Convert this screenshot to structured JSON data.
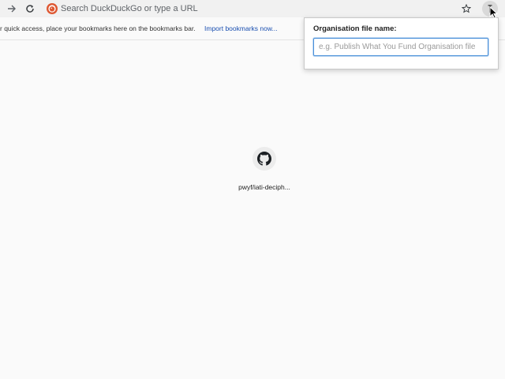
{
  "toolbar": {
    "forward_icon": "arrow-right-icon",
    "reload_icon": "reload-icon",
    "omnibox": {
      "logo_icon": "duckduckgo-logo-icon",
      "placeholder": "Search DuckDuckGo or type a URL"
    },
    "bookmark_icon": "star-icon",
    "extension_icon": "extension-icon"
  },
  "bookmarks_bar": {
    "message": "r quick access, place your bookmarks here on the bookmarks bar.",
    "import_link": "Import bookmarks now..."
  },
  "popup": {
    "label": "Organisation file name:",
    "input_placeholder": "e.g. Publish What You Fund Organisation file",
    "input_value": ""
  },
  "shortcut_tile": {
    "icon": "github-icon",
    "label": "pwyf/iati-deciph..."
  },
  "colors": {
    "link": "#1a4fb0",
    "focus_ring": "#4a90d9",
    "duckduckgo_orange": "#de5833"
  }
}
